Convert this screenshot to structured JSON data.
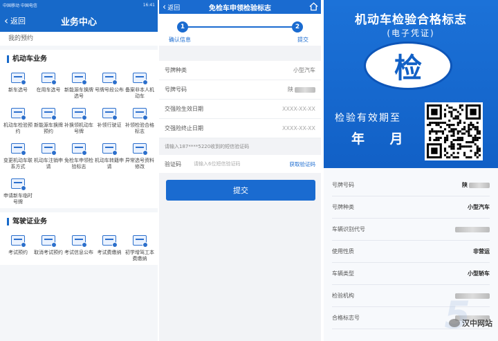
{
  "panel1": {
    "status_left": "中国移动 中国电信",
    "status_right": "16:41",
    "back_label": "返回",
    "title": "业务中心",
    "partial_text": "我的预约",
    "sections": [
      {
        "title": "机动车业务",
        "items": [
          {
            "label": "新车选号",
            "icon": "car-doc-icon"
          },
          {
            "label": "在用车选号",
            "icon": "car-icon"
          },
          {
            "label": "新能源车换牌选号",
            "icon": "ev-car-icon"
          },
          {
            "label": "号牌号段公布",
            "icon": "plate-icon"
          },
          {
            "label": "备案非本人机动车",
            "icon": "person-card-icon"
          },
          {
            "label": "机动车检验预约",
            "icon": "inspection-icon"
          },
          {
            "label": "新能源车换牌预约",
            "icon": "calendar-icon"
          },
          {
            "label": "补换领机动车号牌",
            "icon": "plate-replace-icon"
          },
          {
            "label": "补领行驶证",
            "icon": "license-icon"
          },
          {
            "label": "补领检验合格标志",
            "icon": "diamond-icon"
          },
          {
            "label": "变更机动车联系方式",
            "icon": "contact-icon"
          },
          {
            "label": "机动车注销申请",
            "icon": "cancel-doc-icon"
          },
          {
            "label": "免检车申领检验标志",
            "icon": "badge-icon"
          },
          {
            "label": "机动车转籍申请",
            "icon": "transfer-icon"
          },
          {
            "label": "异常选号资料修改",
            "icon": "edit-icon"
          },
          {
            "label": "申请新车临时号牌",
            "icon": "temp-plate-icon"
          }
        ]
      },
      {
        "title": "驾驶证业务",
        "items": [
          {
            "label": "考试预约",
            "icon": "exam-icon"
          },
          {
            "label": "取消考试预约",
            "icon": "calendar-cancel-icon"
          },
          {
            "label": "考试信息公布",
            "icon": "info-icon"
          },
          {
            "label": "考试费缴纳",
            "icon": "pay-icon"
          },
          {
            "label": "初学增驾工本费缴纳",
            "icon": "fee-icon"
          }
        ]
      }
    ]
  },
  "panel2": {
    "back_label": "返回",
    "title": "免检车申领检验标志",
    "steps": [
      {
        "num": "1",
        "label": "确认信息"
      },
      {
        "num": "2",
        "label": "提交"
      }
    ],
    "rows": [
      {
        "key": "号牌种类",
        "value": "小型汽车",
        "blurred": false
      },
      {
        "key": "号牌号码",
        "value": "陕",
        "blurred": true
      },
      {
        "key": "交强险生效日期",
        "value": "XXXX-XX-XX",
        "blurred": false
      },
      {
        "key": "交强险终止日期",
        "value": "XXXX-XX-XX",
        "blurred": false
      }
    ],
    "hint": "请输入187****5220收到的短信验证码",
    "vcode_label": "验证码",
    "vcode_placeholder": "请输入6位短信验证码",
    "vcode_button": "获取验证码",
    "submit_label": "提交"
  },
  "panel3": {
    "title": "机动车检验合格标志",
    "subtitle": "(电子凭证)",
    "emblem_char": "检",
    "validity_label": "检验有效期至",
    "year_month": "年 月",
    "rows": [
      {
        "key": "号牌号码",
        "value": "陕",
        "blurred": true
      },
      {
        "key": "号牌种类",
        "value": "小型汽车",
        "blurred": false
      },
      {
        "key": "车辆识别代号",
        "value": "",
        "blurred": true
      },
      {
        "key": "使用性质",
        "value": "非营运",
        "blurred": false
      },
      {
        "key": "车辆类型",
        "value": "小型轿车",
        "blurred": false
      },
      {
        "key": "检验机构",
        "value": "",
        "blurred": true
      },
      {
        "key": "合格标志号",
        "value": "",
        "blurred": true
      }
    ],
    "watermark": "汉中网站"
  },
  "colors": {
    "primary": "#1769c9",
    "primary_dark": "#1160c6"
  }
}
